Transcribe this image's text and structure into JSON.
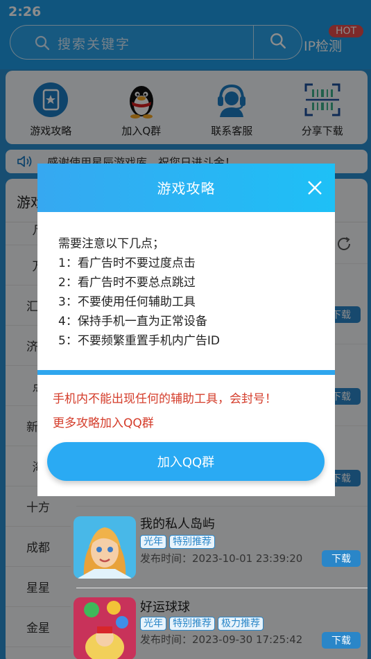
{
  "status_bar": {
    "time": "2:26"
  },
  "search": {
    "placeholder": "搜索关键字",
    "ip_check": "IP检测",
    "hot_badge": "HOT"
  },
  "quick_actions": [
    {
      "label": "游戏攻略",
      "icon": "guide-book-icon"
    },
    {
      "label": "加入Q群",
      "icon": "qq-penguin-icon"
    },
    {
      "label": "联系客服",
      "icon": "customer-service-icon"
    },
    {
      "label": "分享下载",
      "icon": "qr-scan-icon"
    }
  ],
  "notice": {
    "text": "感谢使用星辰游戏库，祝您日进斗金！"
  },
  "list": {
    "tab_title": "游戏",
    "categories": [
      "凡",
      "万",
      "汇服",
      "济南",
      "点",
      "新厦",
      "海",
      "十方",
      "成都",
      "星星",
      "金星"
    ],
    "download_label": "下载",
    "apps": [
      {
        "name": "我的私人岛屿",
        "tags": [
          "光年",
          "特别推荐"
        ],
        "time": "发布时间：2023-10-01 23:39:20"
      },
      {
        "name": "好运球球",
        "tags": [
          "光年",
          "特别推荐",
          "极力推荐"
        ],
        "time": "发布时间：2023-09-30 17:25:42"
      }
    ]
  },
  "dialog": {
    "title": "游戏攻略",
    "body_lines": [
      "需要注意以下几点；",
      "1：看广告时不要过度点击",
      "2：看广告时不要总点跳过",
      "3：不要使用任何辅助工具",
      "4：保持手机一直为正常设备",
      "5：不要频繁重置手机内广告ID"
    ],
    "warning": "手机内不能出现任何的辅助工具，会封号！",
    "more": "更多攻略加入QQ群",
    "button": "加入QQ群"
  },
  "colors": {
    "primary": "#1e9be6",
    "warning": "#d43c2a",
    "download": "#2a86c8"
  }
}
